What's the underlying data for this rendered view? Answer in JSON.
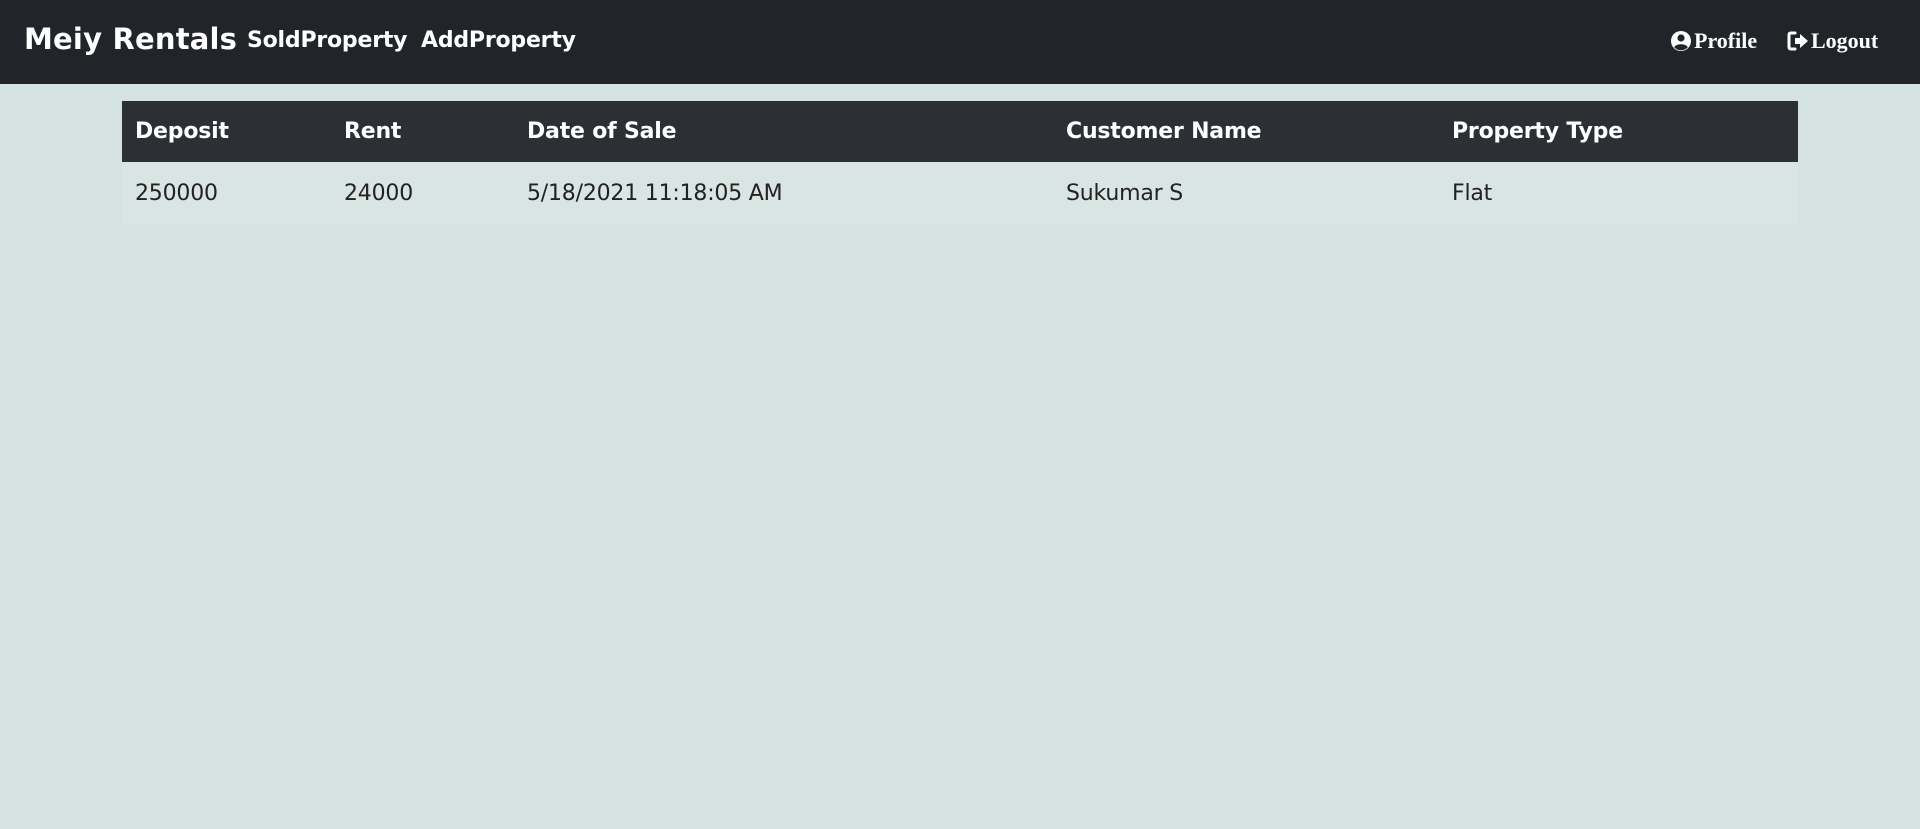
{
  "navbar": {
    "brand": "Meiy Rentals",
    "links": [
      "SoldProperty",
      "AddProperty"
    ],
    "profile_label": "Profile",
    "logout_label": "Logout",
    "profile_icon": "user-circle-icon",
    "logout_icon": "sign-out-icon"
  },
  "table": {
    "headers": [
      "Deposit",
      "Rent",
      "Date of Sale",
      "Customer Name",
      "Property Type"
    ],
    "rows": [
      [
        "250000",
        "24000",
        "5/18/2021 11:18:05 AM",
        "Sukumar S",
        "Flat"
      ]
    ]
  },
  "colors": {
    "navbar_bg": "#212529",
    "page_bg": "#d4e2e0",
    "table_header_bg": "#2c3035"
  }
}
